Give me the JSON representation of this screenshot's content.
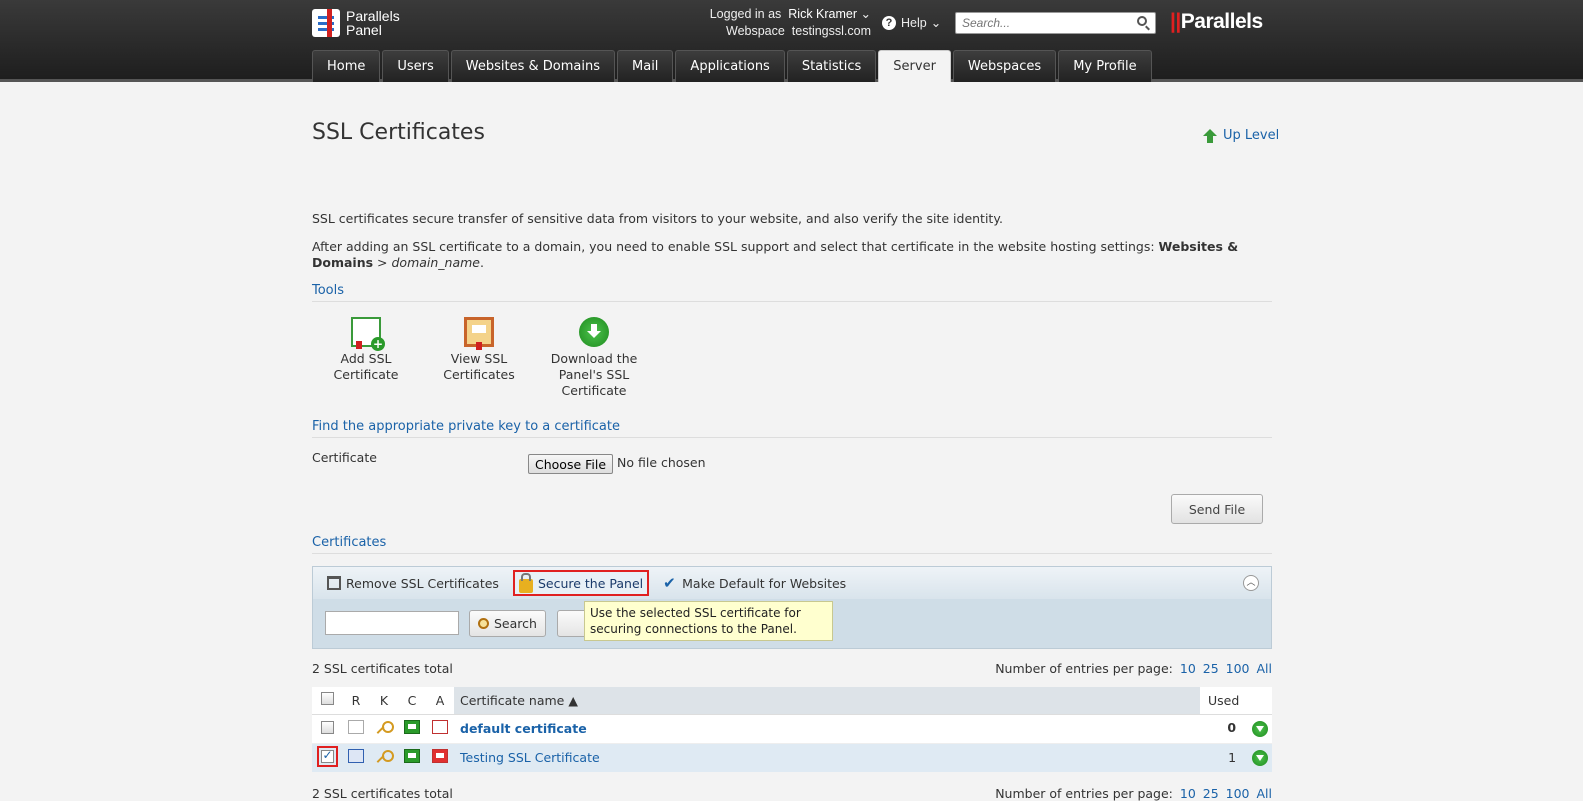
{
  "header": {
    "logo_line1": "Parallels",
    "logo_line2": "Panel",
    "logged_in_label": "Logged in as",
    "user_name": "Rick Kramer",
    "webspace_label": "Webspace",
    "webspace_value": "testingssl.com",
    "help_label": "Help",
    "search_placeholder": "Search...",
    "brand": "Parallels"
  },
  "tabs": [
    {
      "label": "Home"
    },
    {
      "label": "Users"
    },
    {
      "label": "Websites & Domains"
    },
    {
      "label": "Mail"
    },
    {
      "label": "Applications"
    },
    {
      "label": "Statistics"
    },
    {
      "label": "Server",
      "active": true
    },
    {
      "label": "Webspaces"
    },
    {
      "label": "My Profile"
    }
  ],
  "page": {
    "title": "SSL Certificates",
    "up_level": "Up Level",
    "intro1": "SSL certificates secure transfer of sensitive data from visitors to your website, and also verify the site identity.",
    "intro2_plain": "After adding an SSL certificate to a domain, you need to enable SSL support and select that certificate in the website hosting settings: ",
    "intro2_bold": "Websites & Domains",
    "intro2_sep": " > ",
    "intro2_italic": "domain_name",
    "intro2_end": "."
  },
  "tools": {
    "heading": "Tools",
    "add_line1": "Add SSL",
    "add_line2": "Certificate",
    "view_line1": "View SSL",
    "view_line2": "Certificates",
    "dl_line1": "Download the",
    "dl_line2": "Panel's SSL",
    "dl_line3": "Certificate"
  },
  "privkey": {
    "heading": "Find the appropriate private key to a certificate",
    "label": "Certificate",
    "choose_file": "Choose File",
    "no_file": "No file chosen",
    "send_file": "Send File"
  },
  "certificates": {
    "heading": "Certificates",
    "remove": "Remove SSL Certificates",
    "secure_panel": "Secure the Panel",
    "make_default": "Make Default for Websites",
    "search_btn": "Search",
    "tooltip": "Use the selected SSL certificate for securing connections to the Panel.",
    "total": "2 SSL certificates total",
    "per_page_label": "Number of entries per page:",
    "per_page_options": [
      "10",
      "25",
      "100",
      "All"
    ],
    "columns": {
      "r": "R",
      "k": "K",
      "c": "C",
      "a": "A",
      "name": "Certificate name",
      "used": "Used"
    },
    "rows": [
      {
        "name": "default certificate",
        "used": "0"
      },
      {
        "name": "Testing SSL Certificate",
        "used": "1"
      }
    ]
  },
  "colors": {
    "accent": "#1a62a8",
    "highlight": "#e02020",
    "topbar": "#2a2a2a"
  }
}
